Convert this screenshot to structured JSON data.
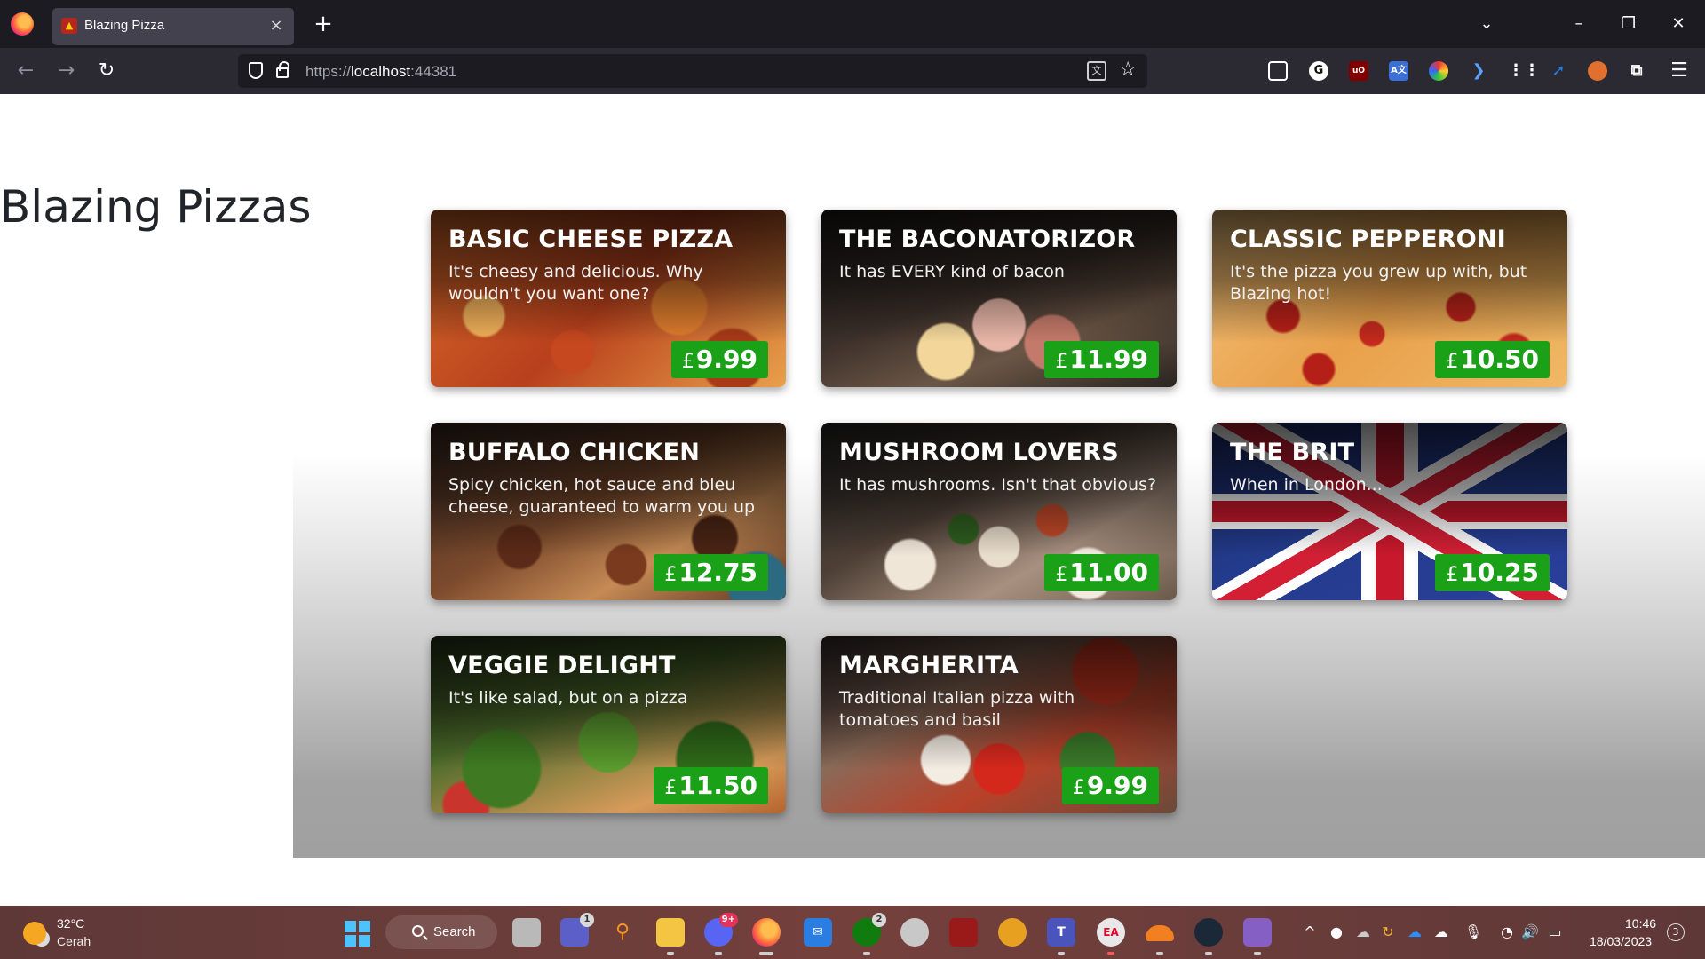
{
  "browser": {
    "tab_title": "Blazing Pizza",
    "tab_close": "×",
    "new_tab": "+",
    "url_scheme": "https://",
    "url_host": "localhost",
    "url_port": ":44381",
    "controls": {
      "list_tabs": "⌄",
      "minimize": "–",
      "restore": "❐",
      "close": "✕"
    },
    "nav": {
      "back": "←",
      "forward": "→",
      "reload": "↻",
      "menu": "☰"
    },
    "extensions": [
      "pocket-icon",
      "grammarly-icon",
      "ublock-icon",
      "translate-icon",
      "colorzilla-icon",
      "arrow-ext-icon",
      "apps-grid-icon",
      "blue-ext-icon",
      "fox-ext-icon",
      "puzzle-icon"
    ]
  },
  "page": {
    "title": "Blazing Pizzas",
    "currency": "£",
    "pizzas": [
      {
        "name": "BASIC CHEESE PIZZA",
        "description": "It's cheesy and delicious. Why wouldn't you want one?",
        "price": "9.99"
      },
      {
        "name": "THE BACONATORIZOR",
        "description": "It has EVERY kind of bacon",
        "price": "11.99"
      },
      {
        "name": "CLASSIC PEPPERONI",
        "description": "It's the pizza you grew up with, but Blazing hot!",
        "price": "10.50"
      },
      {
        "name": "BUFFALO CHICKEN",
        "description": "Spicy chicken, hot sauce and bleu cheese, guaranteed to warm you up",
        "price": "12.75"
      },
      {
        "name": "MUSHROOM LOVERS",
        "description": "It has mushrooms. Isn't that obvious?",
        "price": "11.00"
      },
      {
        "name": "THE BRIT",
        "description": "When in London...",
        "price": "10.25"
      },
      {
        "name": "VEGGIE DELIGHT",
        "description": "It's like salad, but on a pizza",
        "price": "11.50"
      },
      {
        "name": "MARGHERITA",
        "description": "Traditional Italian pizza with tomatoes and basil",
        "price": "9.99"
      }
    ]
  },
  "taskbar": {
    "weather_temp": "32°C",
    "weather_desc": "Cerah",
    "search_label": "Search",
    "teams_badge": "1",
    "discord_badge": "9+",
    "xbox_badge": "2",
    "time": "10:46",
    "date": "18/03/2023",
    "notifications": "3"
  }
}
